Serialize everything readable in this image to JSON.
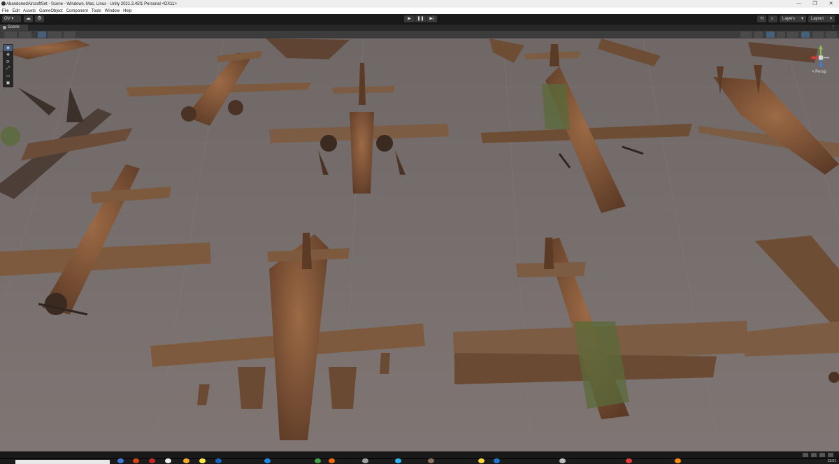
{
  "window": {
    "title": "AbandonedAircraftSet - Scene - Windows, Mac, Linux - Unity 2021.3.45f1 Personal <DX11>",
    "controls": [
      "—",
      "❐",
      "✕"
    ]
  },
  "menu": [
    "File",
    "Edit",
    "Assets",
    "GameObject",
    "Component",
    "Tools",
    "Window",
    "Help"
  ],
  "toolbar": {
    "account_label": "OV",
    "play_icons": [
      "▶",
      "❚❚",
      "▶|"
    ],
    "layers_label": "Layers",
    "layout_label": "Layout"
  },
  "scene_tab": {
    "label": "Scene"
  },
  "gizmo": {
    "projection_label": "< Persp"
  },
  "taskbar": {
    "time": "13:01"
  },
  "colors": {
    "floor": "#7c7471",
    "grid": "#8a8280",
    "rust": "#8a5a3a",
    "rust_dark": "#5b3a26",
    "moss": "#5a6b3a",
    "accent": "#46607c"
  },
  "icons": {
    "tools": [
      "view-hand-icon",
      "move-icon",
      "rotate-icon",
      "scale-icon",
      "rect-icon",
      "transform-icon"
    ]
  }
}
